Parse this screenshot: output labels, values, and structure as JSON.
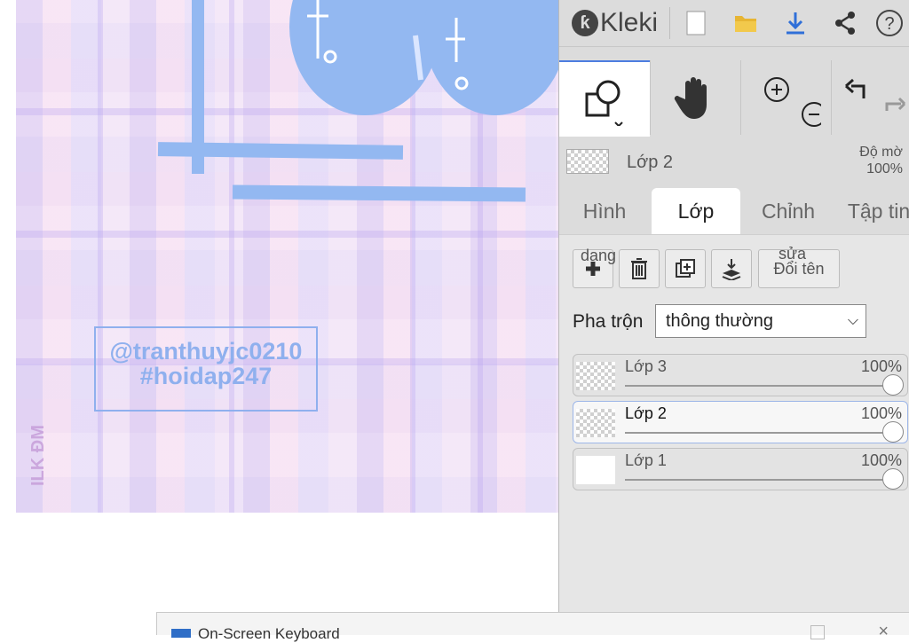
{
  "canvas": {
    "watermark_line1": "@tranthuyjc0210",
    "watermark_line2": "#hoidap247",
    "side_text": "ILK ĐM"
  },
  "app": {
    "name": "Kleki"
  },
  "toolbar": {
    "icons": [
      "new-file-icon",
      "open-folder-icon",
      "download-icon",
      "share-icon",
      "help-icon"
    ],
    "help_label": "?"
  },
  "tools": [
    "shape-select-icon",
    "hand-icon",
    "zoom-icon",
    "undo-redo-icon"
  ],
  "current_layer": {
    "name": "Lớp 2",
    "opacity_label": "Độ mờ",
    "opacity": "100%"
  },
  "tabs": [
    {
      "label": "Hình",
      "active": false
    },
    {
      "label": "Lớp",
      "active": true
    },
    {
      "label": "Chỉnh",
      "active": false
    },
    {
      "label": "Tập tin",
      "active": false
    }
  ],
  "layer_buttons": {
    "add_overlay": "dang",
    "rename_overlay": "sửa",
    "rename_label": "Đổi tên"
  },
  "blend": {
    "label": "Pha trộn",
    "value": "thông thường"
  },
  "layers": [
    {
      "name": "Lớp 3",
      "opacity": "100%",
      "opacity_value": 1.0,
      "selected": false
    },
    {
      "name": "Lớp 2",
      "opacity": "100%",
      "opacity_value": 1.0,
      "selected": true
    },
    {
      "name": "Lớp 1",
      "opacity": "100%",
      "opacity_value": 1.0,
      "selected": false
    }
  ],
  "taskbar": {
    "title": "On-Screen Keyboard"
  },
  "colors": {
    "accent": "#4c7de0",
    "panel_bg": "#dcdcdc",
    "drawing_blue": "#93b8f1"
  }
}
